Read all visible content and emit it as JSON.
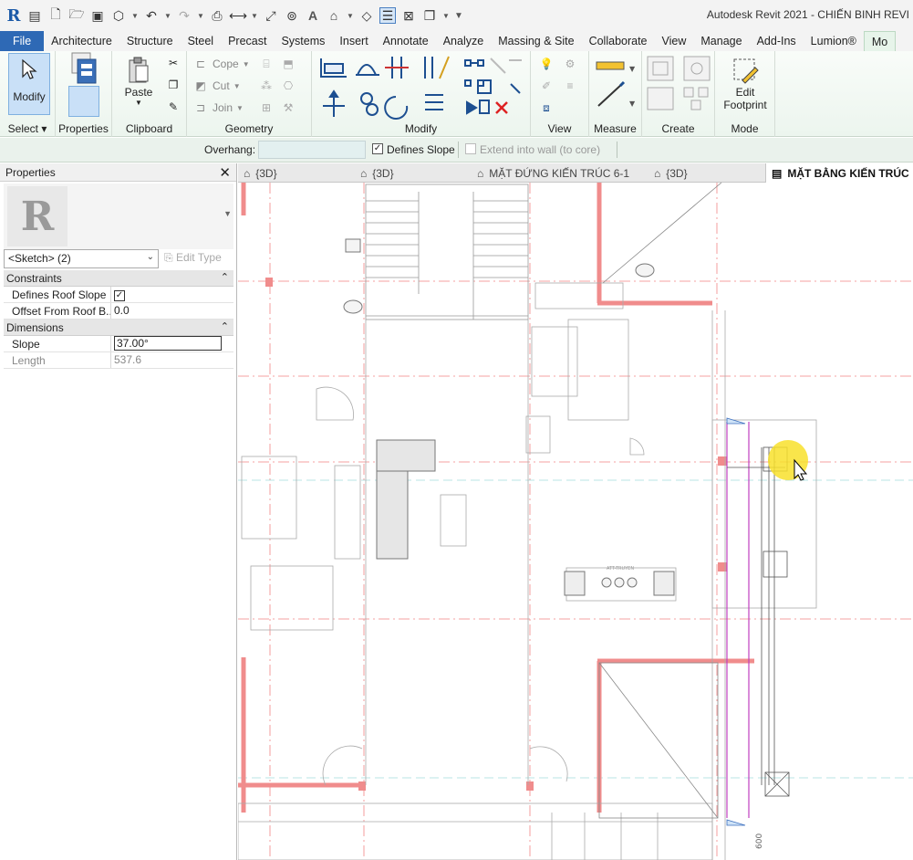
{
  "window": {
    "title": "Autodesk Revit 2021 - CHIẾN BINH REVI"
  },
  "ribbon": {
    "tabs": [
      "File",
      "Architecture",
      "Structure",
      "Steel",
      "Precast",
      "Systems",
      "Insert",
      "Annotate",
      "Analyze",
      "Massing & Site",
      "Collaborate",
      "View",
      "Manage",
      "Add-Ins",
      "Lumion®",
      "Mo"
    ],
    "active_tab": "Mo",
    "groups": {
      "select": {
        "label": "Select",
        "modify": "Modify"
      },
      "properties": {
        "label": "Properties"
      },
      "clipboard": {
        "label": "Clipboard",
        "paste": "Paste"
      },
      "geometry": {
        "label": "Geometry",
        "cope": "Cope",
        "cut": "Cut",
        "join": "Join"
      },
      "modify": {
        "label": "Modify"
      },
      "view": {
        "label": "View"
      },
      "measure": {
        "label": "Measure"
      },
      "create": {
        "label": "Create"
      },
      "mode": {
        "label": "Mode",
        "edit_footprint_line1": "Edit",
        "edit_footprint_line2": "Footprint"
      }
    }
  },
  "options_bar": {
    "overhang_label": "Overhang:",
    "defines_slope_label": "Defines Slope",
    "defines_slope_checked": true,
    "extend_label": "Extend into wall (to core)",
    "extend_checked": false
  },
  "properties": {
    "title": "Properties",
    "selector": "<Sketch> (2)",
    "edit_type": "Edit Type",
    "sections": [
      {
        "name": "Constraints",
        "rows": [
          {
            "key": "Defines Roof Slope",
            "value": "☑"
          },
          {
            "key": "Offset From Roof B...",
            "value": "0.0"
          }
        ]
      },
      {
        "name": "Dimensions",
        "rows": [
          {
            "key": "Slope",
            "value": "37.00°"
          },
          {
            "key": "Length",
            "value": "537.6"
          }
        ]
      }
    ]
  },
  "view_tabs": [
    {
      "label": "{3D}"
    },
    {
      "label": "{3D}"
    },
    {
      "label": "MẶT ĐỨNG KIẾN TRÚC 6-1"
    },
    {
      "label": "{3D}"
    },
    {
      "label": "MẶT BẰNG KIẾN TRÚC",
      "active": true
    }
  ],
  "canvas": {
    "dimension_text": "600",
    "label_small": "ATT-TRUYEN"
  },
  "colors": {
    "accent": "#2e69b5",
    "wall_red": "#f08c8c",
    "sketch_magenta": "#c040c0",
    "grid_red": "#e66"
  }
}
